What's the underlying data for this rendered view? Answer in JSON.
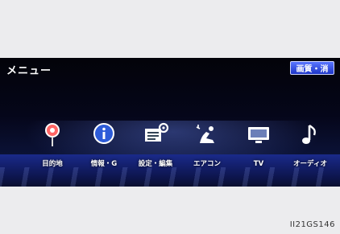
{
  "header": {
    "title": "メニュー",
    "screen_off_label": "画質・消"
  },
  "menu": {
    "items": [
      {
        "label": "目的地",
        "icon": "destination-pin-icon"
      },
      {
        "label": "情報・G",
        "icon": "info-icon"
      },
      {
        "label": "設定・編集",
        "icon": "settings-icon"
      },
      {
        "label": "エアコン",
        "icon": "climate-icon"
      },
      {
        "label": "TV",
        "icon": "tv-icon"
      },
      {
        "label": "オーディオ",
        "icon": "audio-note-icon"
      }
    ]
  },
  "figure_code": "II21GS146",
  "colors": {
    "accent": "#2a46e0",
    "background": "#05061a"
  }
}
